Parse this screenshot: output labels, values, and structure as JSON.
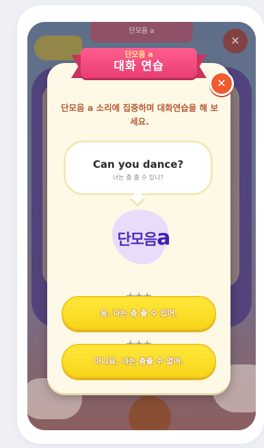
{
  "background": {
    "top_banner": "단모음 a",
    "colors": {
      "overlay": "#7a6e86",
      "board": "#4d3c7a"
    }
  },
  "modal": {
    "ribbon_sub": "단모음 a",
    "title": "대화 연습",
    "instruction": "단모음 a 소리에 집중하며 대화연습을 해 보세요.",
    "bubble": {
      "english": "Can you dance?",
      "korean": "너는 춤 출 수 있니?"
    },
    "vowel_card": {
      "text": "단모음",
      "letter": "a"
    },
    "answers": [
      {
        "label": "응, 나는 춤 출 수 있어.",
        "stars": 3
      },
      {
        "label": "아니요, 나는 춤출 수 없어.",
        "stars": 3
      }
    ],
    "colors": {
      "ribbon": "#e83f73",
      "close": "#ef5a2e",
      "answer": "#f7d51a",
      "instruction": "#b75b38",
      "vowel": "#4c2fb8"
    },
    "icons": {
      "close": "close-icon",
      "star": "star-icon"
    }
  }
}
